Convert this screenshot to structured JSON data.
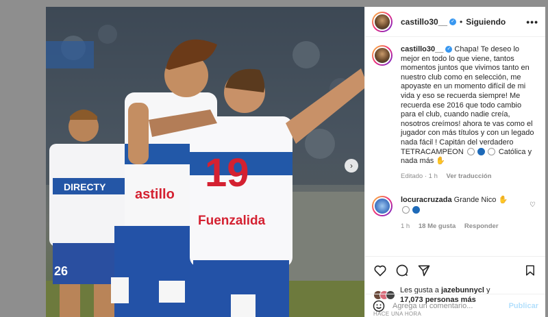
{
  "post": {
    "username": "castillo30__",
    "follow_status": "Siguiendo",
    "separator": "•",
    "more_label": "•••"
  },
  "caption": {
    "username": "castillo30__",
    "text": " Chapa! Te deseo lo mejor en todo lo que viene, tantos momentos juntos que vivimos tanto en nuestro club como en selección, me apoyaste en un momento difícil de mi vida y eso se recuerda siempre! Me recuerda ese 2016 que todo cambio para el club, cuando nadie creía, nosotros creímos! ahora te vas como el jugador con más títulos y con un legado nada fácil ! Capitán del verdadero TETRACAMPEON",
    "tail": "Católica y nada más",
    "edited": "Editado · 1 h",
    "translate": "Ver traducción"
  },
  "comment": {
    "username": "locuracruzada",
    "text": "Grande Nico",
    "time": "1 h",
    "likes": "18 Me gusta",
    "reply": "Responder"
  },
  "photo": {
    "jersey_sponsor": "DIRECTY",
    "jersey_brand1": "astillo",
    "jersey_brand2": "Fuenzalida",
    "number": "19",
    "number_left": "26"
  },
  "likes": {
    "prefix": "Les gusta a ",
    "user": "jazebunnycl",
    "suffix": " y",
    "count": "17,073 personas más"
  },
  "timestamp": "HACE UNA HORA",
  "composer": {
    "placeholder": "Agrega un comentario...",
    "publish": "Publicar"
  },
  "icons": [
    "heart-icon",
    "comment-icon",
    "share-icon",
    "bookmark-icon",
    "emoji-icon",
    "chevron-right-icon",
    "verified-icon"
  ],
  "colors": {
    "accent": "#3897f0",
    "publish_disabled": "#b2dffc",
    "club_blue": "#1e6ab8"
  }
}
